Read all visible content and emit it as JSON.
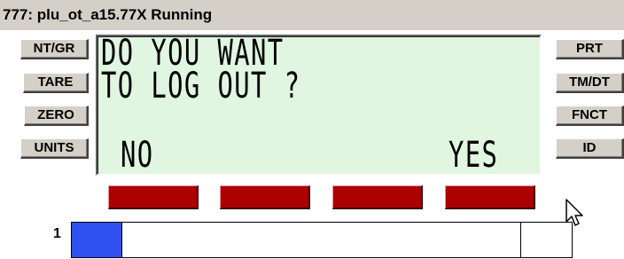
{
  "window": {
    "title": "777: plu_ot_a15.77X Running"
  },
  "left_buttons": [
    "NT/GR",
    "TARE",
    "ZERO",
    "UNITS"
  ],
  "right_buttons": [
    "PRT",
    "TM/DT",
    "FNCT",
    "ID"
  ],
  "display": {
    "line1": "DO YOU WANT",
    "line2": "TO LOG OUT ?",
    "softkey_left": "NO",
    "softkey_right": "YES",
    "background_color": "#e0f6e0"
  },
  "softkey_bar_color": "#aa0000",
  "scale": {
    "number": "1",
    "progress_fraction": 0.1,
    "fill_color": "#3050f0"
  },
  "icons": {
    "cursor": "mouse-pointer-icon"
  }
}
